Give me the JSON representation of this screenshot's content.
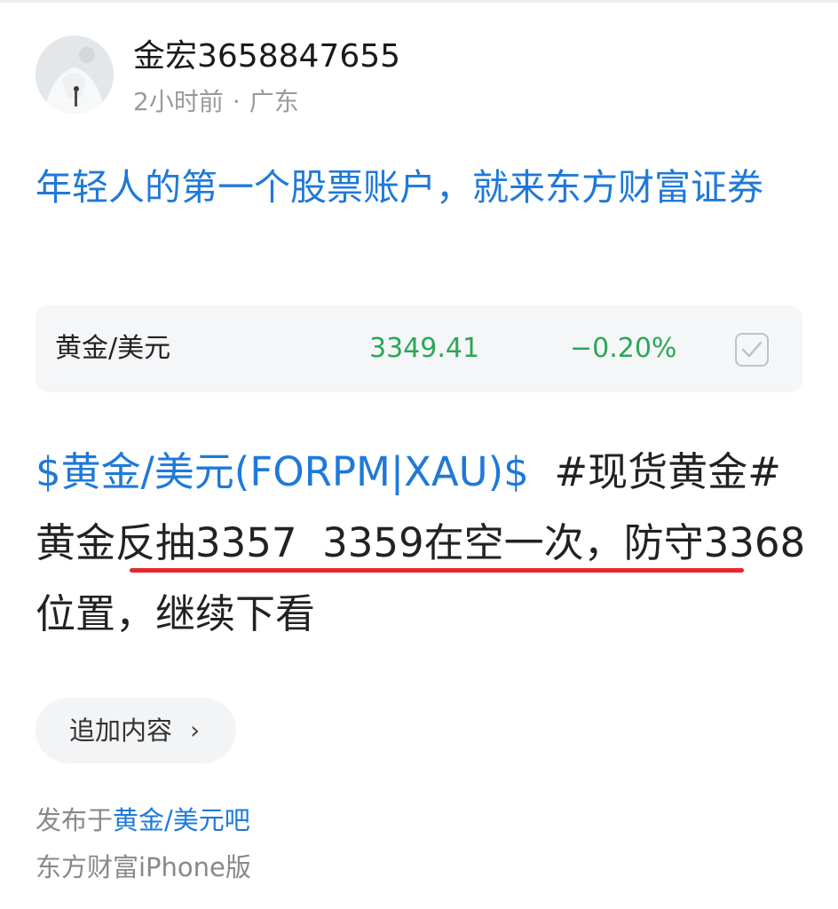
{
  "author": {
    "name": "金宏3658847655",
    "time": "2小时前",
    "separator": "·",
    "location": "广东"
  },
  "promo": {
    "text": "年轻人的第一个股票账户，就来东方财富证券"
  },
  "stock_card": {
    "name": "黄金/美元",
    "price": "3349.41",
    "change": "−0.20%",
    "price_color": "#2aa756"
  },
  "post": {
    "stock_tag": "$黄金/美元(FORPM|XAU)$",
    "topic_tag": "#现货黄金#",
    "text_underlined": "黄金反抽3357  3359在空一次，",
    "text_rest": "防守3368位置，继续下看"
  },
  "add_content": {
    "label": "追加内容",
    "chevron": "›"
  },
  "footer": {
    "published_prefix": "发布于",
    "board_name": "黄金/美元吧",
    "client": "东方财富iPhone版"
  },
  "colors": {
    "link_blue": "#1f79d8",
    "underline_red": "#e8262d"
  }
}
